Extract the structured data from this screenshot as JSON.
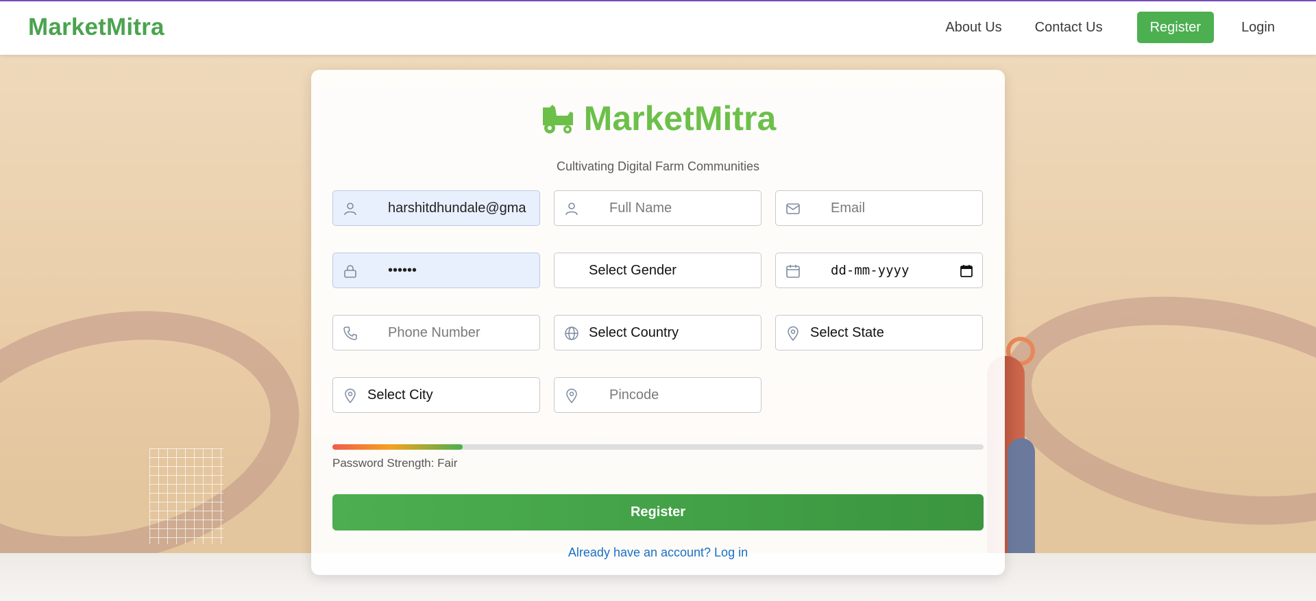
{
  "navbar": {
    "brand": "MarketMitra",
    "links": [
      "About Us",
      "Contact Us"
    ],
    "register": "Register",
    "login": "Login"
  },
  "card": {
    "logo_text": "MarketMitra",
    "tagline": "Cultivating Digital Farm Communities",
    "fields": {
      "username": {
        "value": "harshitdhundale@gma",
        "icon": "user-icon"
      },
      "full_name": {
        "placeholder": "Full Name",
        "icon": "user-icon"
      },
      "email": {
        "placeholder": "Email",
        "icon": "mail-icon"
      },
      "password": {
        "value": "••••••",
        "icon": "lock-icon"
      },
      "gender": {
        "value": "Select Gender"
      },
      "dob": {
        "value": "dd-mm-yyyy",
        "icon": "calendar-icon"
      },
      "phone": {
        "placeholder": "Phone Number",
        "icon": "phone-icon"
      },
      "country": {
        "value": "Select Country",
        "icon": "globe-icon"
      },
      "state": {
        "value": "Select State",
        "icon": "location-pin-icon"
      },
      "city": {
        "value": "Select City",
        "icon": "location-pin-icon"
      },
      "pincode": {
        "placeholder": "Pincode",
        "icon": "location-pin-icon"
      }
    },
    "password_strength": {
      "label": "Password Strength: Fair",
      "level": 0.2
    },
    "submit": "Register",
    "login_link": "Already have an account? Log in"
  },
  "colors": {
    "brand": "#4aa34f",
    "logo": "#6cc04a",
    "button": "#4caf50",
    "link": "#1a6fc4"
  }
}
